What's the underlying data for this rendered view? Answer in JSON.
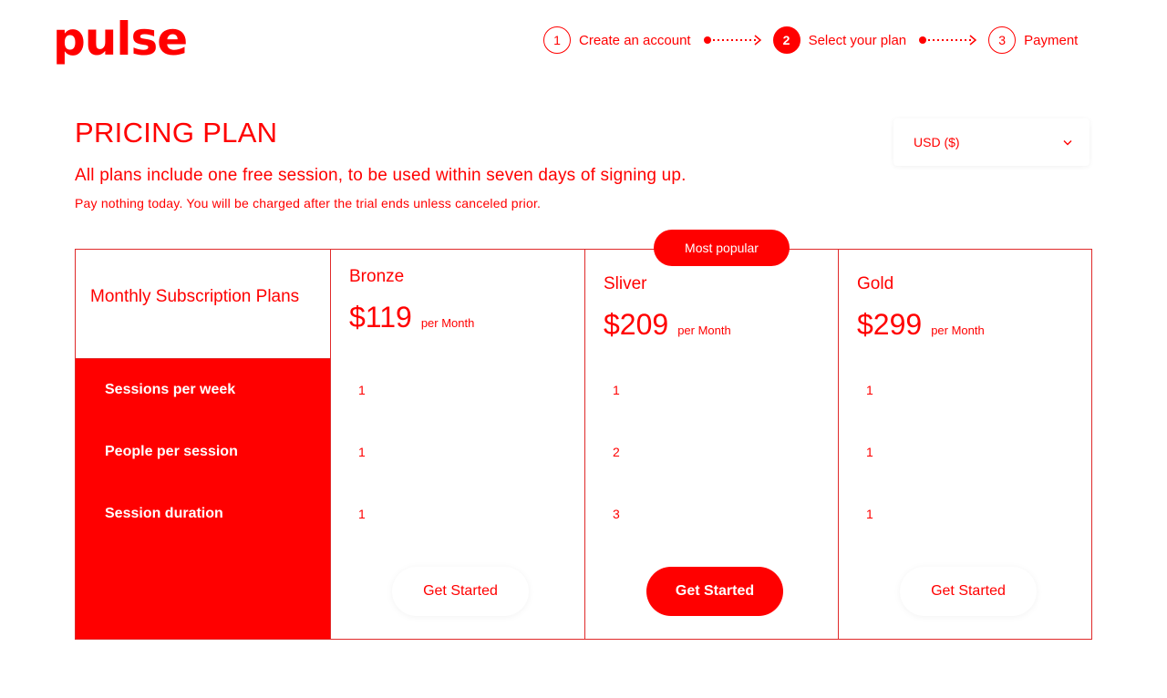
{
  "brand": {
    "logo": "pulse",
    "accent": "#ff0000"
  },
  "steps": [
    {
      "number": "1",
      "label": "Create an account",
      "active": false
    },
    {
      "number": "2",
      "label": "Select your plan",
      "active": true
    },
    {
      "number": "3",
      "label": "Payment",
      "active": false
    }
  ],
  "page": {
    "title": "PRICING PLAN",
    "subtitle": "All plans include one free session, to be used within seven days of signing up.",
    "note": "Pay nothing today. You will be charged after the trial ends unless canceled prior."
  },
  "currency": {
    "selected": "USD ($)",
    "icon": "chevron-down-icon"
  },
  "table": {
    "header_label": "Monthly Subscription Plans",
    "features": [
      "Sessions per week",
      "People per session",
      "Session duration"
    ],
    "popular_badge": "Most popular",
    "plans": [
      {
        "name": "Bronze",
        "price": "$119",
        "period": "per Month",
        "values": [
          "1",
          "1",
          "1"
        ],
        "cta": "Get Started",
        "highlighted": false
      },
      {
        "name": "Sliver",
        "price": "$209",
        "period": "per Month",
        "values": [
          "1",
          "2",
          "3"
        ],
        "cta": "Get Started",
        "highlighted": true
      },
      {
        "name": "Gold",
        "price": "$299",
        "period": "per Month",
        "values": [
          "1",
          "1",
          "1"
        ],
        "cta": "Get Started",
        "highlighted": false
      }
    ]
  }
}
